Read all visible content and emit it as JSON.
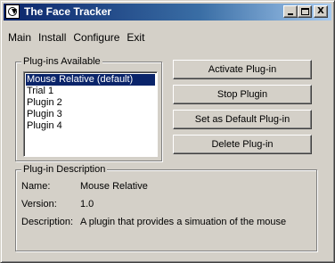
{
  "window": {
    "title": "The Face Tracker",
    "minimize_label": "_",
    "close_label": "X"
  },
  "menu": [
    "Main",
    "Install",
    "Configure",
    "Exit"
  ],
  "plugins": {
    "group_label": "Plug-ins Available",
    "items": [
      "Mouse Relative (default)",
      "Trial 1",
      "Plugin 2",
      "Plugin 3",
      "Plugin 4"
    ],
    "selected_index": 0
  },
  "buttons": {
    "activate": "Activate Plug-in",
    "stop": "Stop Plugin",
    "set_default": "Set as Default Plug-in",
    "delete": "Delete Plug-in"
  },
  "description": {
    "group_label": "Plug-in Description",
    "name_label": "Name:",
    "name_value": "Mouse Relative",
    "version_label": "Version:",
    "version_value": "1.0",
    "description_label": "Description:",
    "description_value": "A plugin that provides a simuation of the mouse"
  },
  "colors": {
    "title_active": "#0a246a",
    "selection": "#0a246a",
    "face": "#d4d0c8"
  }
}
